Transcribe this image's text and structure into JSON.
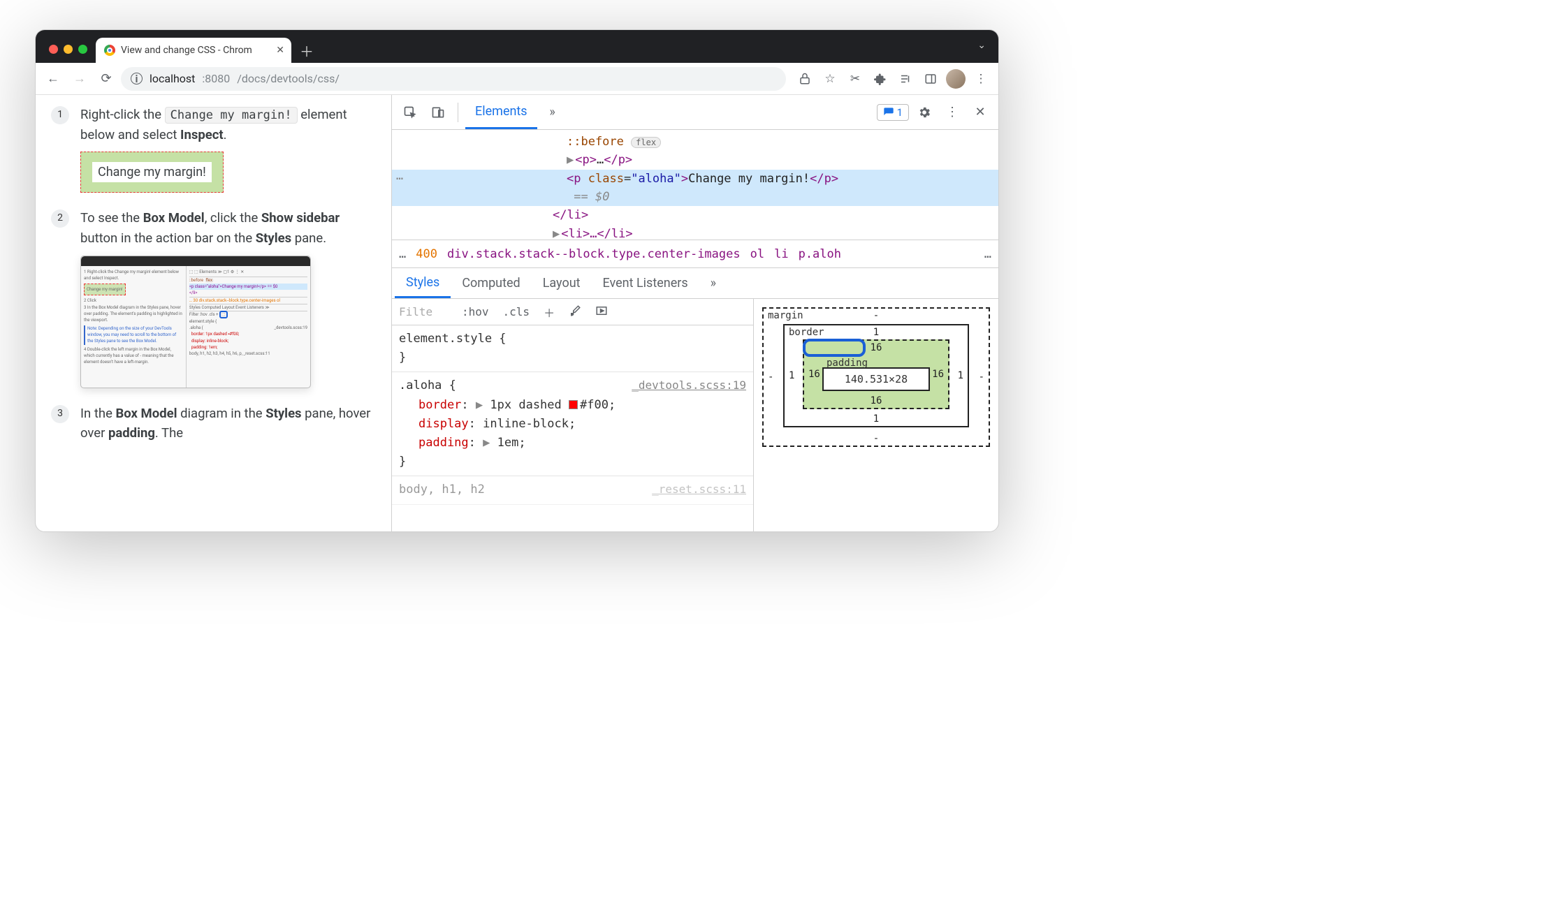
{
  "window": {
    "tab_title": "View and change CSS - Chrom",
    "url_host": "localhost",
    "url_port": ":8080",
    "url_path": "/docs/devtools/css/"
  },
  "page": {
    "step1_a": "Right-click the ",
    "step1_code": "Change my margin!",
    "step1_b": " element below and select ",
    "step1_bold": "Inspect",
    "step1_c": ".",
    "demo_text": "Change my margin!",
    "step2_a": "To see the ",
    "step2_b1": "Box Model",
    "step2_c": ", click the ",
    "step2_b2": "Show sidebar",
    "step2_d": " button in the action bar on the ",
    "step2_b3": "Styles",
    "step2_e": " pane.",
    "step3_a": "In the ",
    "step3_b1": "Box Model",
    "step3_b": " diagram in the ",
    "step3_b2": "Styles",
    "step3_c": " pane, hover over ",
    "step3_b3": "padding",
    "step3_d": ". The"
  },
  "devtools": {
    "main_tabs": {
      "elements": "Elements"
    },
    "issues_count": "1",
    "dom": {
      "before": "::before",
      "flex": "flex",
      "p_open": "<p>",
      "ellipsis": "…",
      "p_close": "</p>",
      "sel_open_tag": "p",
      "sel_attr": "class",
      "sel_val": "aloha",
      "sel_text": "Change my margin!",
      "eq0": "== $0",
      "li_close": "</li>"
    },
    "crumbs": {
      "dots": "…",
      "c0": "400",
      "c1": "div.stack.stack--block.type.center-images",
      "c2": "ol",
      "c3": "li",
      "c4": "p.aloh",
      "more": "…"
    },
    "subtabs": {
      "styles": "Styles",
      "computed": "Computed",
      "layout": "Layout",
      "listeners": "Event Listeners"
    },
    "toolbar": {
      "filter": "Filte",
      "hov": ":hov",
      "cls": ".cls"
    },
    "rules": {
      "r0_sel": "element.style {",
      "r0_close": "}",
      "r1_sel": ".aloha {",
      "r1_src": "_devtools.scss:19",
      "r1_p1": "border",
      "r1_v1": "1px dashed ",
      "r1_v1b": "#f00",
      "r1_p2": "display",
      "r1_v2": "inline-block",
      "r1_p3": "padding",
      "r1_v3": "1em",
      "r1_close": "}",
      "r2_sel": "body, h1, h2",
      "r2_src": "_reset.scss:11"
    },
    "boxmodel": {
      "margin_label": "margin",
      "border_label": "border",
      "padding_label": "padding",
      "content": "140.531×28",
      "margin": {
        "top": "-",
        "right": "-",
        "bottom": "-",
        "left": "-"
      },
      "border": {
        "top": "1",
        "right": "1",
        "bottom": "1",
        "left": "1"
      },
      "padding": {
        "top": "16",
        "right": "16",
        "bottom": "16",
        "left": "16"
      }
    }
  }
}
